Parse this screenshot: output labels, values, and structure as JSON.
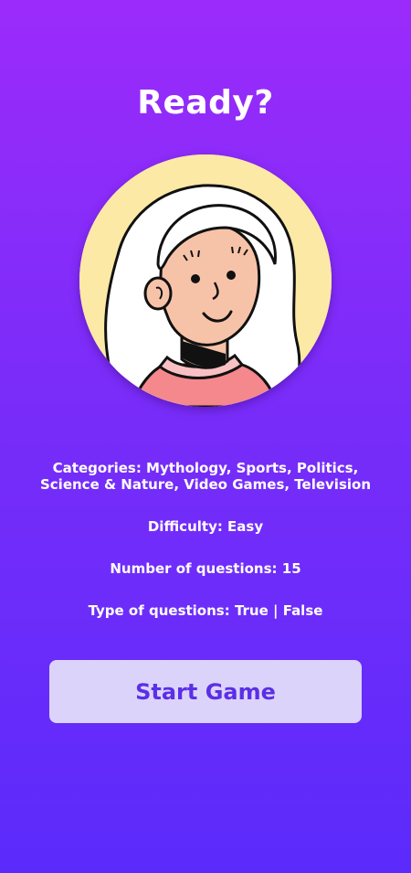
{
  "screen": {
    "title": "Ready?",
    "avatar_icon": "avatar-illustration"
  },
  "info": {
    "categories": "Categories: Mythology, Sports, Politics, Science & Nature, Video Games, Television",
    "difficulty": "Difficulty: Easy",
    "question_count": "Number of questions: 15",
    "question_type": "Type of questions: True | False"
  },
  "actions": {
    "start_label": "Start Game"
  },
  "colors": {
    "background_top": "#9b2bfb",
    "background_bottom": "#5b2bfb",
    "button_background": "#dcd3fb",
    "button_text": "#5a2fe6",
    "avatar_background": "#fde9a6"
  }
}
